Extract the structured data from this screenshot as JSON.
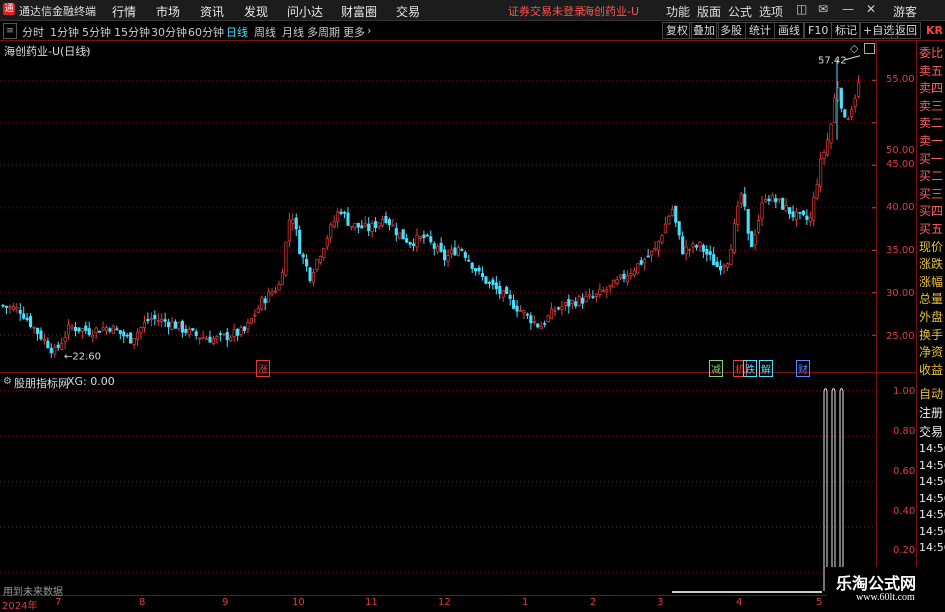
{
  "app": {
    "logo_char": "通",
    "name": "通达信金融终端",
    "menus": [
      "行情",
      "市场",
      "资讯",
      "发现",
      "问小达",
      "财富圈",
      "交易"
    ],
    "login_status": "证券交易未登录",
    "stock_name": "海创药业-U",
    "right_menus": [
      "功能",
      "版面",
      "公式",
      "选项"
    ],
    "user": "游客"
  },
  "toolbar": {
    "timeframes": [
      "分时",
      "1分钟",
      "5分钟",
      "15分钟",
      "30分钟",
      "60分钟",
      "日线",
      "周线",
      "月线",
      "多周期",
      "更多"
    ],
    "active": "日线",
    "buttons": [
      "复权",
      "叠加",
      "多股",
      "统计",
      "画线",
      "F10",
      "标记",
      "+自选",
      "返回"
    ],
    "badge": "KR"
  },
  "main_chart": {
    "title": "海创药业-U(日线)",
    "high_label": "57.42",
    "low_label": "22.60",
    "events": [
      {
        "text": "涨",
        "color": "#e03c3c"
      },
      {
        "text": "减",
        "color": "#80d080"
      },
      {
        "text": "机",
        "color": "#e03c3c"
      },
      {
        "text": "跌",
        "color": "#49e0ff"
      },
      {
        "text": "解",
        "color": "#49e0ff"
      },
      {
        "text": "财",
        "color": "#5a8aff"
      }
    ],
    "colors": {
      "up": "#e03c3c",
      "down": "#49e0ff",
      "grid": "#7a1010"
    }
  },
  "chart_data": [
    {
      "type": "candlestick",
      "title": "海创药业-U(日线)",
      "y_ticks": [
        25.0,
        30.0,
        35.0,
        40.0,
        45.0,
        50.0,
        55.0
      ],
      "ylim": [
        21.5,
        58.8
      ],
      "x_ticks": [
        "2024年",
        "7",
        "8",
        "9",
        "10",
        "11",
        "12",
        "1",
        "2",
        "3",
        "4",
        "5"
      ],
      "high": 57.42,
      "low": 22.6
    },
    {
      "type": "bar",
      "title": "股朋指标网",
      "series": [
        {
          "name": "XG",
          "values": [
            1.0
          ]
        }
      ],
      "y_ticks": [
        0.2,
        0.4,
        0.6,
        0.8,
        1.0
      ],
      "ylim": [
        0.12,
        1.06
      ]
    }
  ],
  "indicator": {
    "name": "股朋指标网",
    "value_text": "XG: 0.00",
    "footer_text": "用到未来数据"
  },
  "side_panel": {
    "items_top": [
      "委比",
      "卖五",
      "卖四",
      "卖三",
      "卖二",
      "卖一",
      "买一",
      "买二",
      "买三",
      "买四",
      "买五",
      "现价",
      "涨跌",
      "涨幅",
      "总量",
      "外盘",
      "换手",
      "净资",
      "收益"
    ],
    "items_bottom": [
      "自动",
      "注册",
      "交易"
    ],
    "times": [
      "14:56",
      "14:56",
      "14:56",
      "14:56",
      "14:56",
      "14:56",
      "14:56"
    ]
  },
  "watermark": {
    "name": "乐淘公式网",
    "url": "www.60lt.com"
  }
}
